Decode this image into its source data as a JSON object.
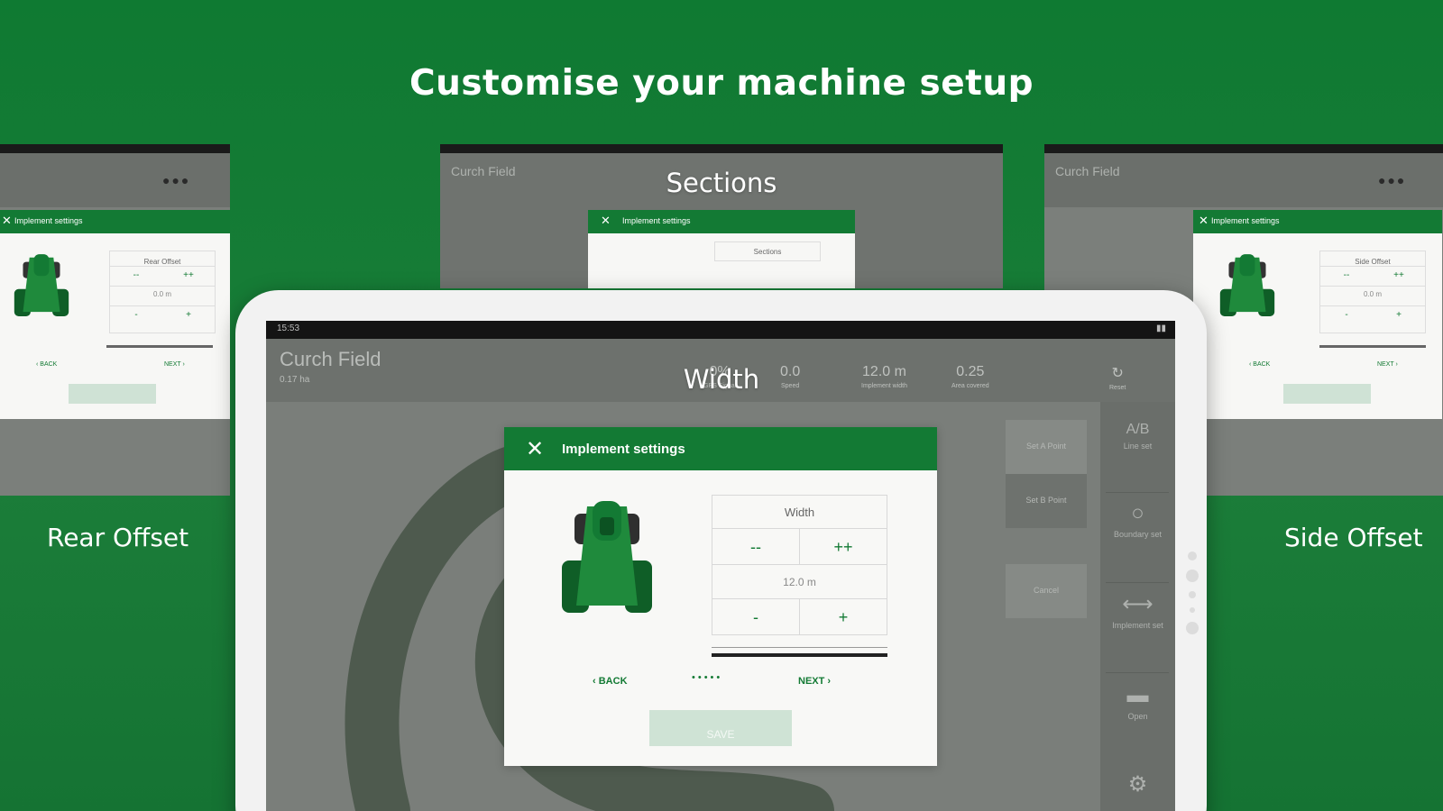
{
  "headline": "Customise your machine setup",
  "labels": {
    "sections": "Sections",
    "width": "Width",
    "rear_offset": "Rear Offset",
    "side_offset": "Side Offset"
  },
  "device": {
    "field_name": "Curch Field",
    "field_area": "0.17 ha",
    "status_time": "15:53",
    "metrics": [
      {
        "value": "0%",
        "label": "GPS Signal"
      },
      {
        "value": "0.0",
        "label": "Speed"
      },
      {
        "value": "12.0 m",
        "label": "Implement width"
      },
      {
        "value": "0.25",
        "label": "Area covered"
      }
    ],
    "reset_label": "Reset",
    "actions": [
      "Set A Point",
      "Set B Point",
      "Cancel"
    ],
    "rail": [
      {
        "icon": "A/B",
        "label": "Line set"
      },
      {
        "icon": "○",
        "label": "Boundary set"
      },
      {
        "icon": "⟷",
        "label": "Implement set"
      },
      {
        "icon": "▬",
        "label": "Open"
      },
      {
        "icon": "⚙",
        "label": ""
      }
    ]
  },
  "dialog": {
    "title": "Implement settings",
    "close": "✕",
    "param_label": "Width",
    "big_minus": "--",
    "big_plus": "++",
    "value": "12.0 m",
    "small_minus": "-",
    "small_plus": "+",
    "back": "BACK",
    "next": "NEXT",
    "step_dots": "•••••",
    "save": "SAVE"
  },
  "left_panel": {
    "dialog_title": "Implement settings",
    "param_label": "Rear Offset",
    "value": "0.0 m",
    "back": "BACK",
    "next": "NEXT",
    "save": "SAVE"
  },
  "right_panel": {
    "field_name": "Curch Field",
    "dialog_title": "Implement settings",
    "param_label": "Side Offset",
    "value": "0.0 m",
    "back": "BACK",
    "next": "NEXT",
    "save": "SAVE"
  },
  "mid_panel": {
    "field_name": "Curch Field",
    "dialog_title": "Implement settings",
    "param_label": "Sections"
  },
  "colors": {
    "brand_green": "#137a34",
    "background_green": "#1b7d39",
    "map_grey": "#7b7f7b"
  }
}
